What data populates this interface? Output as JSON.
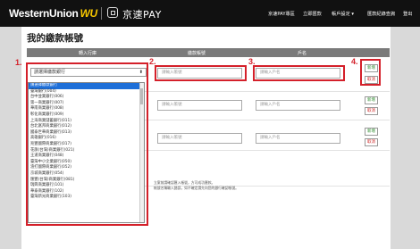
{
  "header": {
    "logo": "WesternUnion",
    "logo_mark": "WU",
    "pay_brand": "京速PAY",
    "nav": [
      "京速PAY專區",
      "立即匯款",
      "帳戶設定 ▾",
      "匯款紀錄查詢",
      "登出"
    ]
  },
  "page": {
    "title": "我的繳款帳號",
    "columns": [
      "轉入行庫",
      "繳款帳號",
      "戶名"
    ]
  },
  "form": {
    "bank_select_value": "請選擇繳款銀行",
    "account_placeholder": "請輸入帳號",
    "name_placeholder": "請輸入戶名",
    "add_label": "新增",
    "cancel_label": "取消"
  },
  "footnotes": [
    "立案前請確認匯入帳號，方可成功匯款。",
    "帳號名稱輸入錯誤，如不確定請先向您的銀行確認帳號。"
  ],
  "dropdown": {
    "options": [
      "請選擇繳款銀行",
      "臺灣銀行(004)",
      "台中並業銀行(006)",
      "第一商業銀行(007)",
      "華南商業銀行(008)",
      "彰化商業銀行(009)",
      "上海商業儲蓄銀行(011)",
      "台北富邦商業銀行(012)",
      "國泰世華商業銀行(013)",
      "高雄銀行(016)",
      "兆豐國際商業銀行(017)",
      "花旗(台灣)商業銀行(021)",
      "王道商業銀行(048)",
      "臺灣中小企業銀行(050)",
      "渣打國際商業銀行(052)",
      "京城商業銀行(054)",
      "匯豐(台灣)商業銀行(081)",
      "瑞興商業銀行(101)",
      "華泰商業銀行(102)",
      "臺灣新光商業銀行(103)"
    ],
    "selected_index": 0
  },
  "annotations": [
    "1.",
    "2.",
    "3.",
    "4."
  ],
  "colors": {
    "highlight": "#d4202a",
    "selected_option": "#1e6fd8",
    "add_text": "#2a8a2a",
    "cancel_text": "#cc2222"
  }
}
